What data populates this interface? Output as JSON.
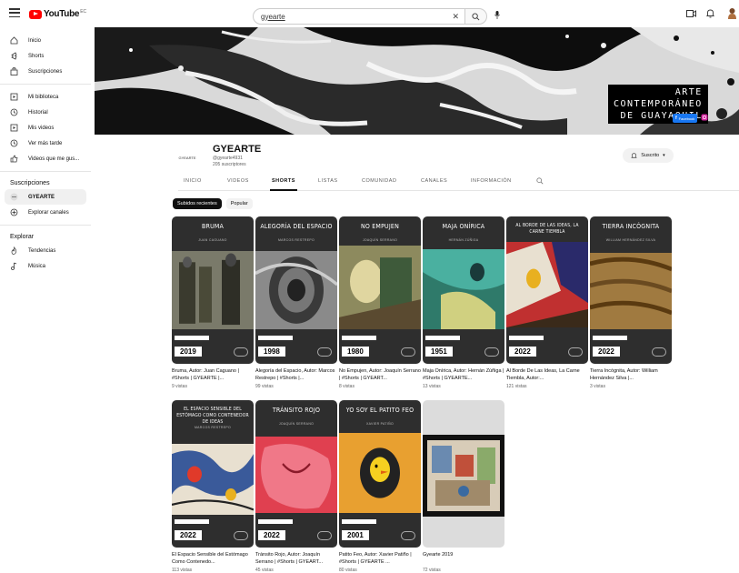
{
  "topbar": {
    "logo_text": "YouTube",
    "logo_country": "EC",
    "search_value": "gyearte"
  },
  "sidebar": {
    "primary": [
      {
        "label": "Inicio",
        "icon": "home-icon"
      },
      {
        "label": "Shorts",
        "icon": "shorts-icon"
      },
      {
        "label": "Suscripciones",
        "icon": "subscriptions-icon"
      }
    ],
    "library": [
      {
        "label": "Mi biblioteca",
        "icon": "library-icon"
      },
      {
        "label": "Historial",
        "icon": "history-icon"
      },
      {
        "label": "Mis videos",
        "icon": "your-videos-icon"
      },
      {
        "label": "Ver más tarde",
        "icon": "watch-later-icon"
      },
      {
        "label": "Videos que me gus...",
        "icon": "liked-icon"
      }
    ],
    "subs_header": "Suscripciones",
    "subs": [
      {
        "label": "GYEARTE",
        "icon": "channel-avatar"
      },
      {
        "label": "Explorar canales",
        "icon": "explore-channels-icon"
      }
    ],
    "explore_header": "Explorar",
    "explore": [
      {
        "label": "Tendencias",
        "icon": "trending-icon"
      },
      {
        "label": "Música",
        "icon": "music-icon"
      }
    ]
  },
  "banner": {
    "line1": "ARTE",
    "line2": "CONTEMPORÁNEO",
    "line3": "DE GUAYAQUIL",
    "facebook_label": "Facebook"
  },
  "channel": {
    "avatar_text": "GYEARTE",
    "name": "GYEARTE",
    "handle": "@gyearte4931",
    "subs": "205 suscriptores",
    "subscribe_label": "Suscrito"
  },
  "tabs": [
    "INICIO",
    "VIDEOS",
    "SHORTS",
    "LISTAS",
    "COMUNIDAD",
    "CANALES",
    "INFORMACIÓN"
  ],
  "chips": [
    "Subidos recientes",
    "Popular"
  ],
  "shorts": [
    {
      "thumb_title": "BRUMA",
      "thumb_sub": "JUAN CAGUANO",
      "year": "2019",
      "title": "Bruma, Autor: Juan Caguano | #Shorts | GYEARTE |...",
      "views": "9 vistas",
      "bg": "#2e2e2e"
    },
    {
      "thumb_title": "ALEGORÍA DEL ESPACIO",
      "thumb_sub": "MARCOS RESTREPO",
      "year": "1998",
      "title": "Alegoría del Espacio, Autor: Marcos Restrepo | #Shorts |...",
      "views": "99 vistas",
      "bg": "#2e2e2e"
    },
    {
      "thumb_title": "NO EMPUJEN",
      "thumb_sub": "JOAQUÍN SERRANO",
      "year": "1980",
      "title": "No Empujen, Autor: Joaquín Serrano | #Shorts | GYEART...",
      "views": "8 vistas",
      "bg": "#2e2e2e"
    },
    {
      "thumb_title": "MAJA ONÍRICA",
      "thumb_sub": "HERNÁN ZÚÑIGA",
      "year": "1951",
      "title": "Maja Onírica, Autor: Hernán Zúñiga | #Shorts | GYEARTE...",
      "views": "13 vistas",
      "bg": "#2e2e2e"
    },
    {
      "thumb_title": "AL BORDE DE LAS IDEAS, LA CARNE TIEMBLA",
      "thumb_sub": "MARCOS RESTREPO",
      "year": "2022",
      "title": "Al Borde De Las Ideas, La Carne Tiembla, Autor:...",
      "views": "121 vistas",
      "bg": "#2e2e2e"
    },
    {
      "thumb_title": "TIERRA INCÓGNITA",
      "thumb_sub": "WILLIAM HERNÁNDEZ SILVA",
      "year": "2022",
      "title": "Tierra Incógnita, Autor: William Hernández Silva |...",
      "views": "3 vistas",
      "bg": "#2e2e2e"
    },
    {
      "thumb_title": "EL ESPACIO SENSIBLE DEL ESTÓMAGO COMO CONTENEDOR DE IDEAS",
      "thumb_sub": "MARCOS RESTREPO",
      "year": "2022",
      "title": "El Espacio Sensible del Estómago Como Contenedo...",
      "views": "113 vistas",
      "bg": "#2e2e2e"
    },
    {
      "thumb_title": "TRÁNSITO ROJO",
      "thumb_sub": "JOAQUÍN SERRANO",
      "year": "2022",
      "title": "Tránsito Rojo, Autor: Joaquín Serrano | #Shorts | GYEART...",
      "views": "45 vistas",
      "bg": "#2e2e2e"
    },
    {
      "thumb_title": "YO SOY EL PATITO FEO",
      "thumb_sub": "XAVIER PATIÑO",
      "year": "2001",
      "title": "Patito Feo, Autor: Xavier Patiño | #Shorts | GYEARTE ...",
      "views": "80 vistas",
      "bg": "#2e2e2e"
    },
    {
      "thumb_title": "",
      "thumb_sub": "",
      "year": "",
      "title": "Gyearte 2019",
      "views": "72 vistas",
      "bg": "#dcdcdc"
    }
  ]
}
